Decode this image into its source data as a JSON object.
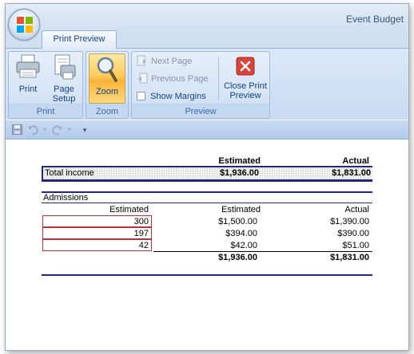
{
  "window": {
    "title": "Event Budget"
  },
  "tabs": [
    {
      "label": "Print Preview",
      "active": true
    }
  ],
  "ribbon": {
    "print_group": {
      "label": "Print",
      "print_button": "Print",
      "page_setup_line1": "Page",
      "page_setup_line2": "Setup"
    },
    "zoom_group": {
      "label": "Zoom",
      "zoom_button": "Zoom"
    },
    "preview_group": {
      "label": "Preview",
      "next_page": "Next Page",
      "previous_page": "Previous Page",
      "show_margins": "Show Margins",
      "close_line1": "Close Print",
      "close_line2": "Preview"
    }
  },
  "quick_access": {
    "icons": [
      "save-icon",
      "undo-icon",
      "redo-icon",
      "customize-icon"
    ]
  },
  "sheet": {
    "header": {
      "estimated": "Estimated",
      "actual": "Actual"
    },
    "total_income": {
      "label": "Total income",
      "estimated": "$1,936.00",
      "actual": "$1,831.00"
    },
    "admissions": {
      "title": "Admissions",
      "columns": {
        "qty": "Estimated",
        "estimated": "Estimated",
        "actual": "Actual"
      },
      "rows": [
        {
          "qty": "300",
          "estimated": "$1,500.00",
          "actual": "$1,390.00"
        },
        {
          "qty": "197",
          "estimated": "$394.00",
          "actual": "$390.00"
        },
        {
          "qty": "42",
          "estimated": "$42.00",
          "actual": "$51.00"
        }
      ],
      "total": {
        "estimated": "$1,936.00",
        "actual": "$1,831.00"
      }
    }
  },
  "colors": {
    "accent": "#15428b",
    "rule": "#1f2a7a",
    "error_border": "#c0303a"
  }
}
